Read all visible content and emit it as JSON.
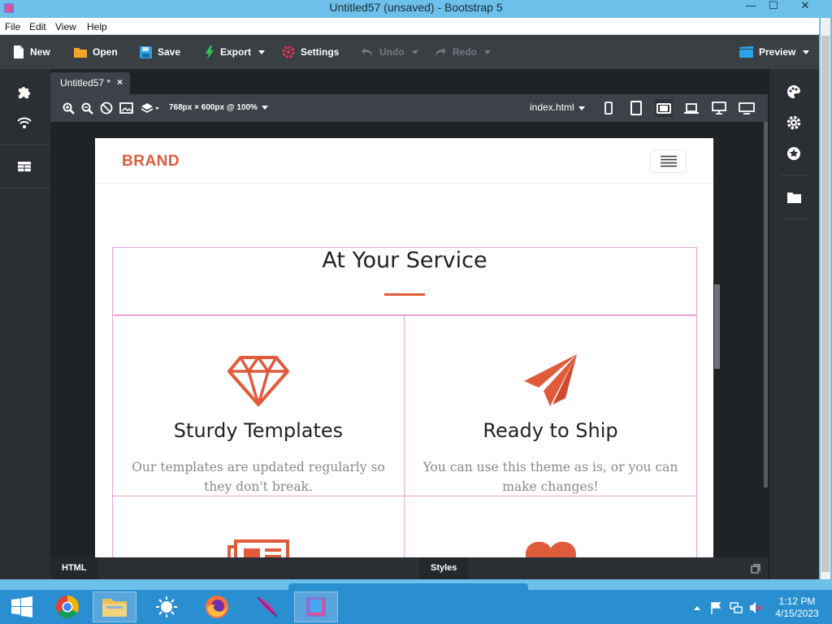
{
  "window": {
    "title": "Untitled57 (unsaved) - Bootstrap 5",
    "minimize": "—",
    "maximize": "☐",
    "close": "✕"
  },
  "menu": [
    "File",
    "Edit",
    "View",
    "Help"
  ],
  "toolbar": {
    "new": "New",
    "open": "Open",
    "save": "Save",
    "export": "Export",
    "settings": "Settings",
    "undo": "Undo",
    "redo": "Redo",
    "preview": "Preview"
  },
  "editor": {
    "tab_label": "Untitled57 *",
    "tab_close": "×",
    "canvas_size": "768px × 600px @ 100%",
    "current_file": "index.html"
  },
  "bottom_tabs": {
    "html": "HTML",
    "styles": "Styles"
  },
  "page": {
    "brand": "BRAND",
    "section_title": "At Your Service",
    "cards": [
      {
        "icon": "gem-icon",
        "title": "Sturdy Templates",
        "text": "Our templates are updated regularly so they don't break."
      },
      {
        "icon": "paper-plane-icon",
        "title": "Ready to Ship",
        "text": "You can use this theme as is, or you can make changes!"
      },
      {
        "icon": "newspaper-icon",
        "title": "",
        "text": ""
      },
      {
        "icon": "heart-icon",
        "title": "",
        "text": ""
      }
    ]
  },
  "taskbar": {
    "time": "1:12 PM",
    "date": "4/15/2023"
  },
  "colors": {
    "accent": "#e05b3c",
    "titlebar": "#6dc0ea",
    "taskbar": "#2a8fd0",
    "app_bg": "#2b2f33",
    "outline": "#e6a3d8"
  }
}
